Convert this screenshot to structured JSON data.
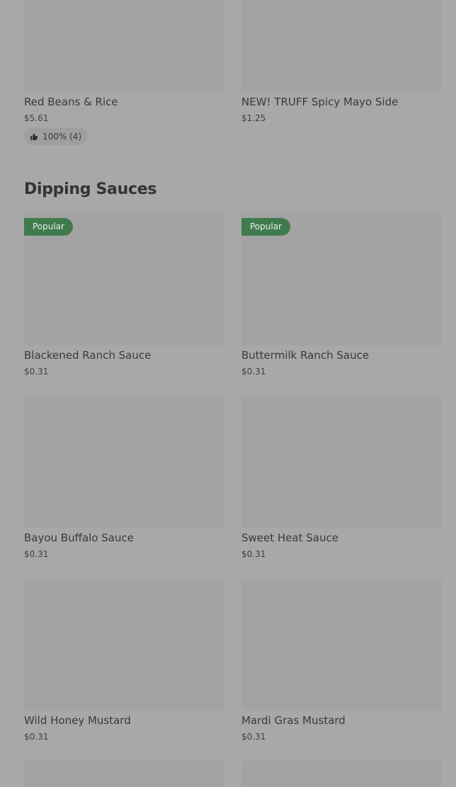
{
  "top_items": [
    {
      "name": "Red Beans & Rice",
      "price": "$5.61",
      "rating": "100% (4)"
    },
    {
      "name": "NEW! TRUFF Spicy Mayo Side",
      "price": "$1.25"
    }
  ],
  "section": {
    "title": "Dipping Sauces",
    "items": [
      {
        "name": "Blackened Ranch Sauce",
        "price": "$0.31",
        "badge": "Popular"
      },
      {
        "name": "Buttermilk Ranch Sauce",
        "price": "$0.31",
        "badge": "Popular"
      },
      {
        "name": "Bayou Buffalo Sauce",
        "price": "$0.31"
      },
      {
        "name": "Sweet Heat Sauce",
        "price": "$0.31"
      },
      {
        "name": "Wild Honey Mustard",
        "price": "$0.31"
      },
      {
        "name": "Mardi Gras Mustard",
        "price": "$0.31"
      }
    ]
  },
  "icons": {
    "rating": "thumbs-up-icon"
  },
  "colors": {
    "badge_background": "#3f7b4d",
    "overlay_background": "#a8a8a8"
  }
}
